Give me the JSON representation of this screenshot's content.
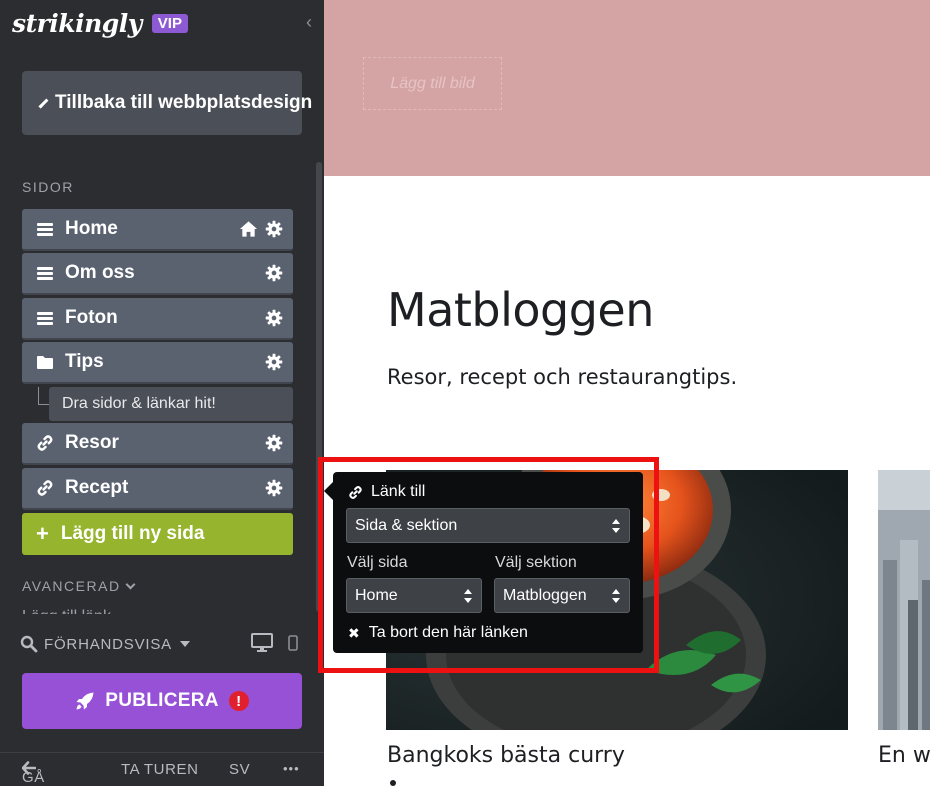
{
  "sidebar": {
    "brand": "strikingly",
    "vip": "VIP",
    "back_label": "Tillbaka till webbplatsdesign",
    "pages_label": "SIDOR",
    "pages": [
      {
        "label": "Home",
        "icon": "menu-icon",
        "home": true
      },
      {
        "label": "Om oss",
        "icon": "menu-icon",
        "home": false
      },
      {
        "label": "Foton",
        "icon": "menu-icon",
        "home": false
      },
      {
        "label": "Tips",
        "icon": "folder-icon",
        "home": false
      },
      {
        "label": "Resor",
        "icon": "link-icon",
        "home": false
      },
      {
        "label": "Recept",
        "icon": "link-icon",
        "home": false
      }
    ],
    "drop_hint": "Dra sidor & länkar hit!",
    "add_page": "Lägg till ny sida",
    "advanced": "AVANCERAD",
    "hidden_row": "Lägg till länk",
    "preview": "FÖRHANDSVISA",
    "publish": "PUBLICERA",
    "publish_alert": "!",
    "footer": {
      "exit": "GÅ UT",
      "tour": "TA TUREN",
      "lang": "SV",
      "more": "•••"
    }
  },
  "canvas": {
    "add_image": "Lägg till bild",
    "title": "Matbloggen",
    "subtitle": "Resor, recept och restaurangtips.",
    "posts": [
      {
        "title": "Bangkoks bästa curry"
      },
      {
        "title": "En w"
      }
    ]
  },
  "link_popover": {
    "heading": "Länk till",
    "link_type": "Sida & sektion",
    "page_label": "Välj sida",
    "section_label": "Välj sektion",
    "page_value": "Home",
    "section_value": "Matbloggen",
    "remove": "Ta bort den här länken"
  },
  "colors": {
    "sidebar_bg": "#2c2d30",
    "page_item": "#5a6270",
    "add_page_green": "#96b42d",
    "publish_purple": "#9751d6",
    "vip_purple": "#8e5ad3",
    "hero_pink": "#d4a4a4",
    "highlight_red": "#ee1111"
  }
}
